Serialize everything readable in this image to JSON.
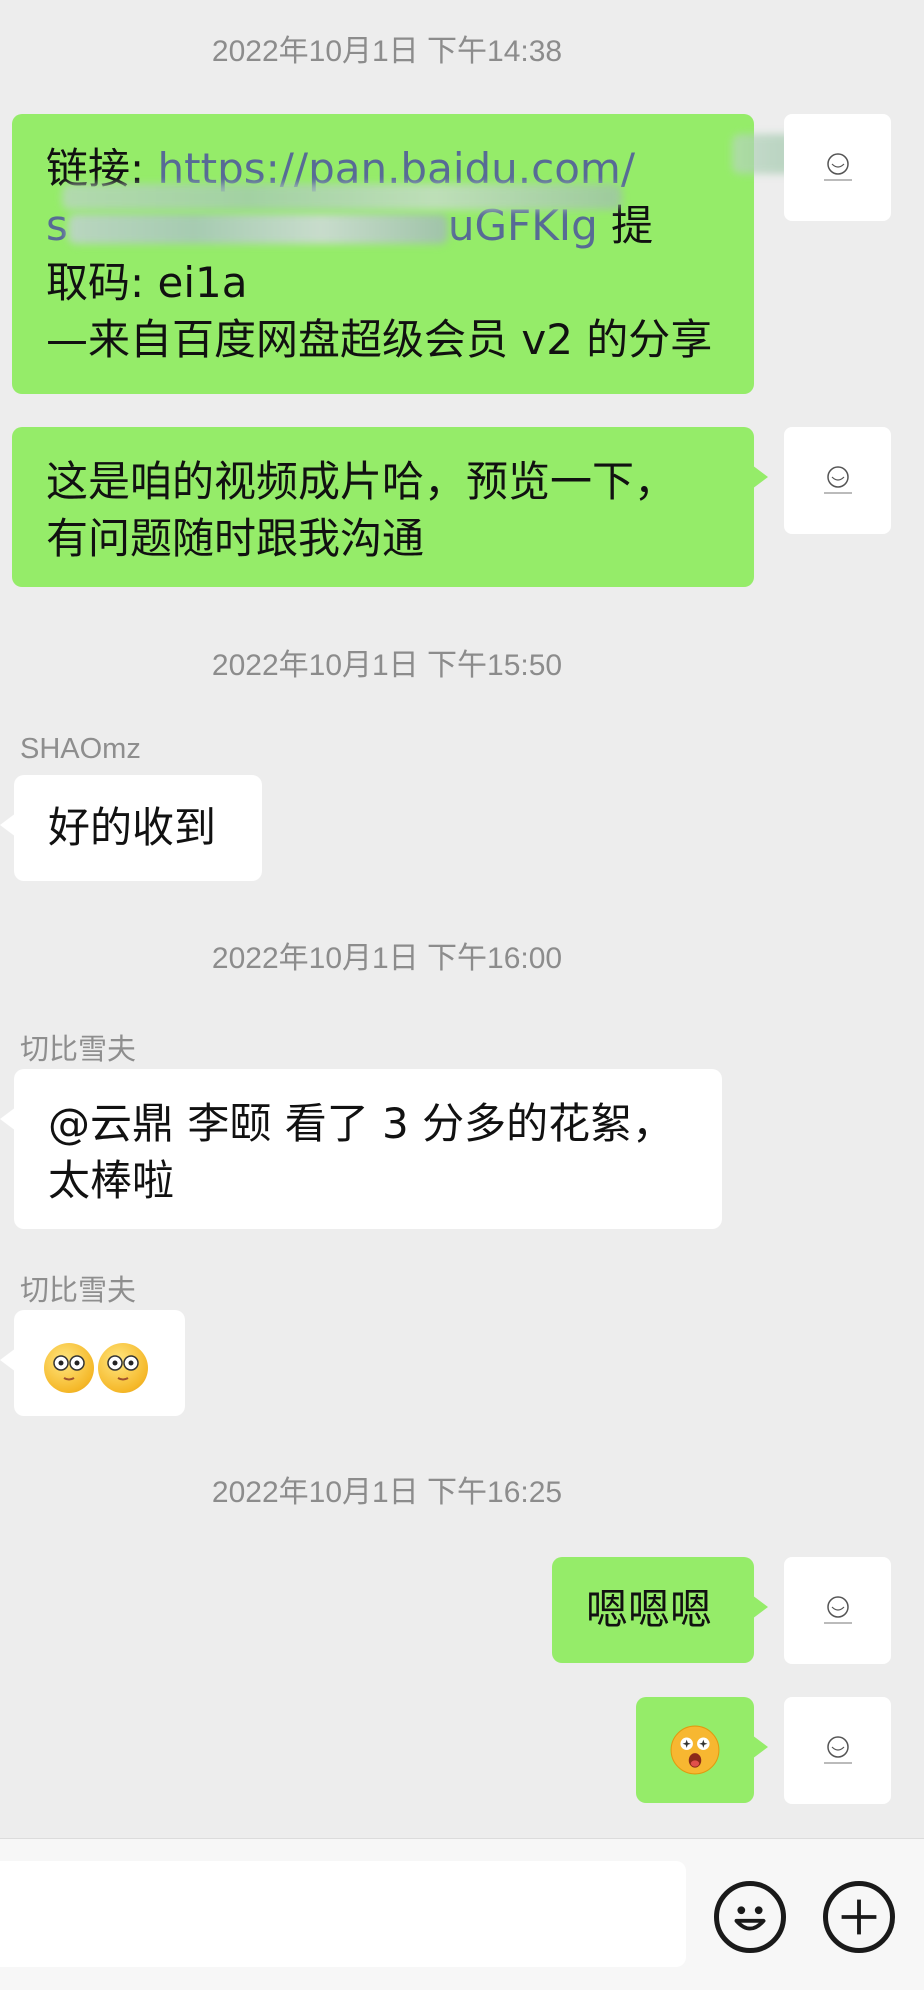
{
  "timestamps": {
    "t1": "2022年10月1日 下午14:38",
    "t2": "2022年10月1日 下午15:50",
    "t3": "2022年10月1日 下午16:00",
    "t4": "2022年10月1日 下午16:25"
  },
  "messages": {
    "m1": {
      "link_prefix": "链接: ",
      "link_line1": "https://pan.baidu.com/",
      "link_line2_start": "s",
      "link_line2_end": "uGFKIg",
      "suffix": " 提",
      "line3": "取码: ei1a",
      "line4": "—来自百度网盘超级会员 v2 的分享"
    },
    "m2": {
      "line1": "这是咱的视频成片哈，预览一下，",
      "line2": "有问题随时跟我沟通"
    },
    "m3": {
      "sender": "SHAOmz",
      "text": "好的收到"
    },
    "m4": {
      "sender": "切比雪夫",
      "line1": "@云鼎 李颐  看了 3 分多的花絮，",
      "line2": "太棒啦"
    },
    "m5": {
      "sender": "切比雪夫"
    },
    "m6": {
      "text": "嗯嗯嗯"
    }
  },
  "colors": {
    "background": "#ededed",
    "green_bubble": "#95ec69",
    "white_bubble": "#ffffff",
    "link": "#576b95",
    "timestamp": "#8c8c8c"
  },
  "icons": {
    "emoji_button": "smile-face-icon",
    "plus_button": "plus-icon",
    "avatar": "sketch-avatar-icon"
  }
}
